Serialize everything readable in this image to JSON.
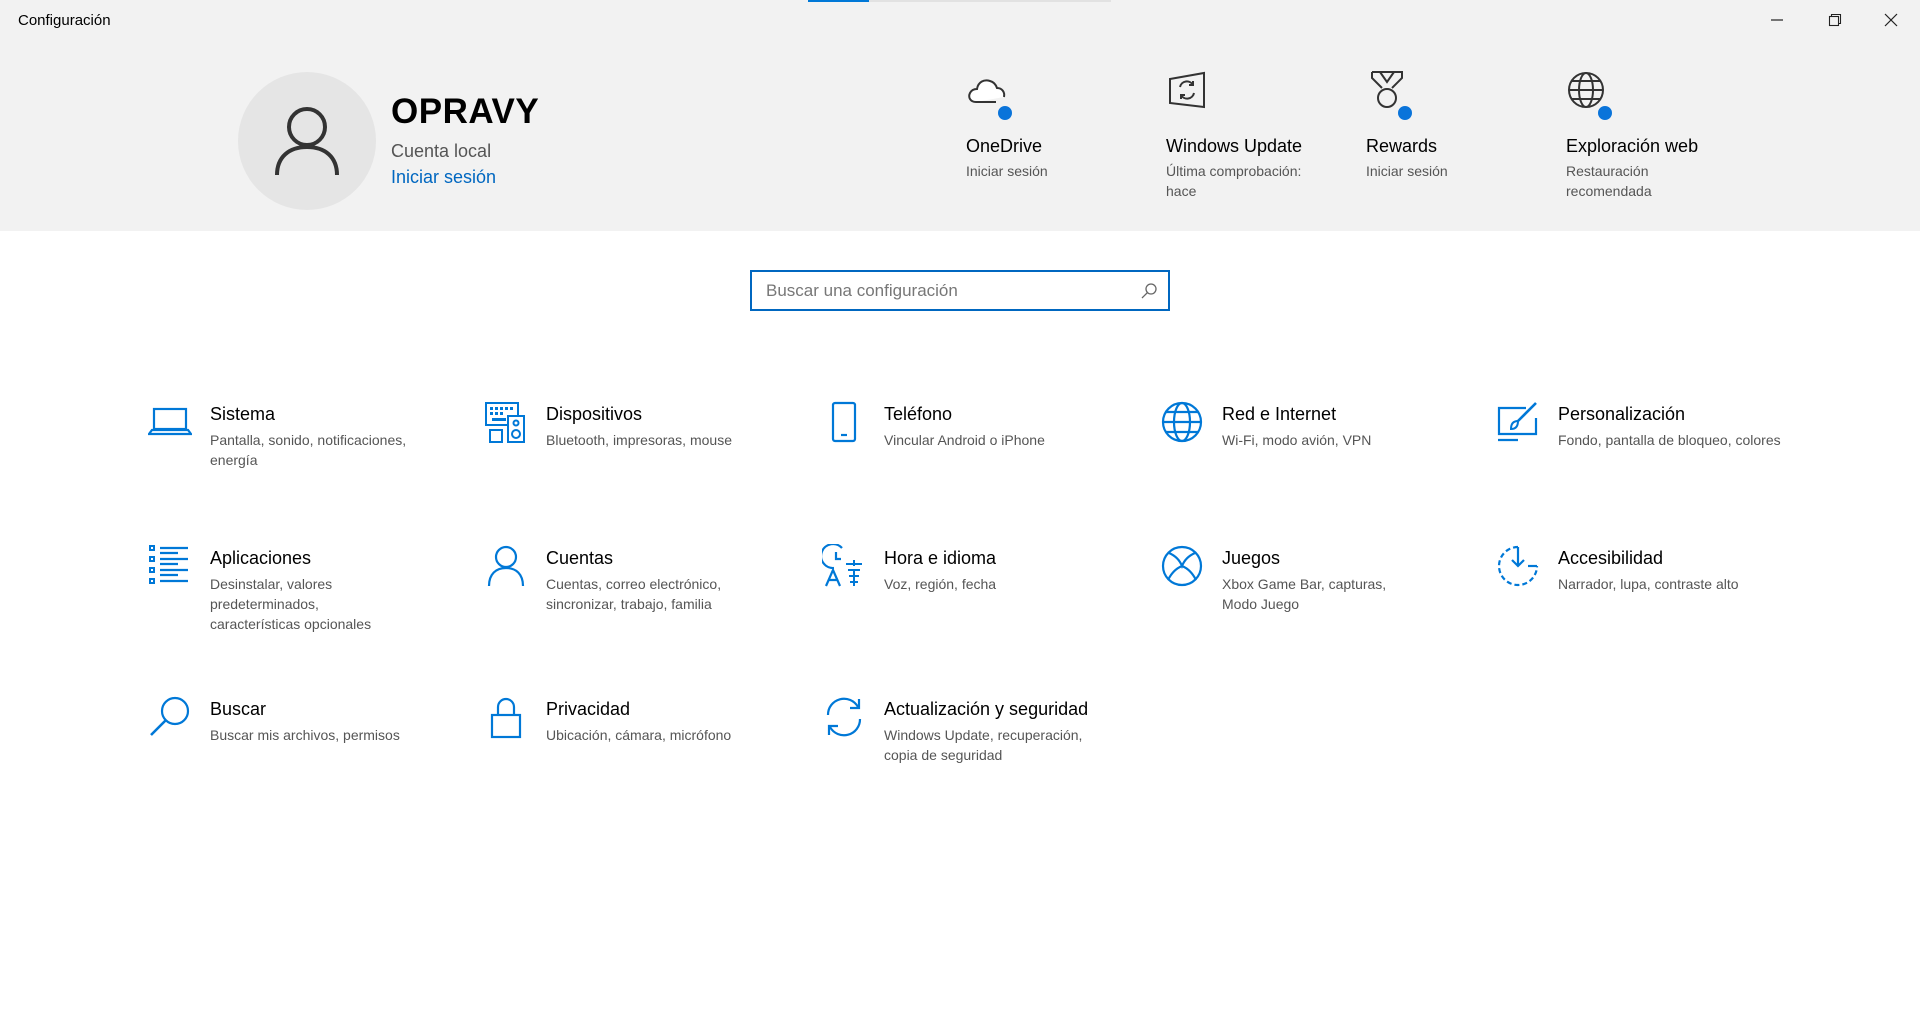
{
  "window": {
    "title": "Configuración",
    "minimize_icon": "minimize-icon",
    "maximize_icon": "restore-icon",
    "close_icon": "close-icon",
    "loading_progress": 0.2
  },
  "profile": {
    "name": "OPRAVY",
    "account_type": "Cuenta local",
    "signin_link": "Iniciar sesión",
    "avatar_icon": "person-icon"
  },
  "quick_links": [
    {
      "title": "OneDrive",
      "subtitle": "Iniciar sesión",
      "icon": "onedrive-cloud-icon",
      "has_badge": true
    },
    {
      "title": "Windows Update",
      "subtitle": "Última comprobación: hace",
      "icon": "windows-update-icon",
      "has_badge": false
    },
    {
      "title": "Rewards",
      "subtitle": "Iniciar sesión",
      "icon": "rewards-medal-icon",
      "has_badge": true
    },
    {
      "title": "Exploración web",
      "subtitle": "Restauración recomendada",
      "icon": "globe-icon",
      "has_badge": true
    }
  ],
  "search": {
    "placeholder": "Buscar una configuración",
    "value": "",
    "icon": "search-icon"
  },
  "categories": [
    {
      "title": "Sistema",
      "subtitle": "Pantalla, sonido, notificaciones, energía",
      "icon": "laptop-icon"
    },
    {
      "title": "Dispositivos",
      "subtitle": "Bluetooth, impresoras, mouse",
      "icon": "devices-icon"
    },
    {
      "title": "Teléfono",
      "subtitle": "Vincular Android o iPhone",
      "icon": "phone-icon"
    },
    {
      "title": "Red e Internet",
      "subtitle": "Wi-Fi, modo avión, VPN",
      "icon": "globe-icon"
    },
    {
      "title": "Personalización",
      "subtitle": "Fondo, pantalla de bloqueo, colores",
      "icon": "paint-icon"
    },
    {
      "title": "Aplicaciones",
      "subtitle": "Desinstalar, valores predeterminados, características opcionales",
      "icon": "apps-list-icon"
    },
    {
      "title": "Cuentas",
      "subtitle": "Cuentas, correo electrónico, sincronizar, trabajo, familia",
      "icon": "person-icon"
    },
    {
      "title": "Hora e idioma",
      "subtitle": "Voz, región, fecha",
      "icon": "time-language-icon"
    },
    {
      "title": "Juegos",
      "subtitle": "Xbox Game Bar, capturas, Modo Juego",
      "icon": "xbox-icon"
    },
    {
      "title": "Accesibilidad",
      "subtitle": "Narrador, lupa, contraste alto",
      "icon": "ease-of-access-icon"
    },
    {
      "title": "Buscar",
      "subtitle": "Buscar mis archivos, permisos",
      "icon": "search-icon"
    },
    {
      "title": "Privacidad",
      "subtitle": "Ubicación, cámara, micrófono",
      "icon": "lock-icon"
    },
    {
      "title": "Actualización y seguridad",
      "subtitle": "Windows Update, recuperación, copia de seguridad",
      "icon": "sync-icon"
    }
  ],
  "colors": {
    "accent": "#0078d7",
    "link": "#0067c0",
    "header_bg": "#f2f2f2"
  }
}
